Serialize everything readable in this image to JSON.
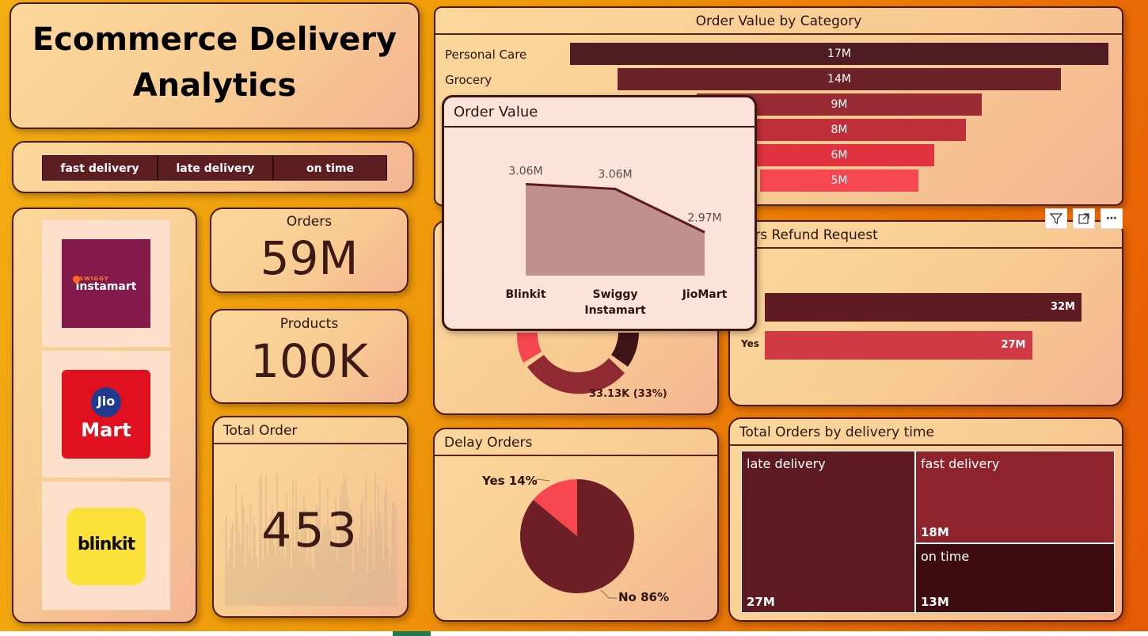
{
  "header": {
    "title_line1": "Ecommerce Delivery",
    "title_line2": "Analytics"
  },
  "filters": {
    "items": [
      "fast delivery",
      "late delivery",
      "on time"
    ]
  },
  "logos": {
    "swiggy_small": "SWIGGY",
    "swiggy_main": "instamart",
    "jio_top": "Jio",
    "jio_bottom": "Mart",
    "blinkit": "blinkit"
  },
  "kpis": {
    "orders_label": "Orders",
    "orders_value": "59M",
    "products_label": "Products",
    "products_value": "100K"
  },
  "total_order": {
    "title": "Total Order",
    "value": "453"
  },
  "order_value_by_category": {
    "title": "Order Value by Category",
    "labels": [
      "Personal Care",
      "Grocery"
    ],
    "bars": [
      {
        "label": "17M",
        "value": 17,
        "color": "#4e1c22"
      },
      {
        "label": "14M",
        "value": 14,
        "color": "#6b2229"
      },
      {
        "label": "9M",
        "value": 9,
        "color": "#9a2a33"
      },
      {
        "label": "8M",
        "value": 8,
        "color": "#c0303b"
      },
      {
        "label": "6M",
        "value": 6,
        "color": "#e0323f"
      },
      {
        "label": "5M",
        "value": 5,
        "color": "#f6464f"
      }
    ]
  },
  "tooltip": {
    "title": "Order Value",
    "chart_data": {
      "type": "area",
      "categories": [
        "Blinkit",
        "Swiggy Instamart",
        "JioMart"
      ],
      "values": [
        3.06,
        3.06,
        2.97
      ],
      "data_labels": [
        "3.06M",
        "3.06M",
        "2.97M"
      ],
      "cat_lines": [
        [
          "Blinkit"
        ],
        [
          "Swiggy",
          "Instamart"
        ],
        [
          "JioMart"
        ]
      ]
    }
  },
  "refund": {
    "title_visible": "ders Refund Request",
    "bars": [
      {
        "category": "",
        "value": 32,
        "label": "32M",
        "color": "#5e1c22"
      },
      {
        "category": "Yes",
        "value": 27,
        "label": "27M",
        "color": "#d03a45"
      }
    ]
  },
  "donut": {
    "label": "33.13K (33%)"
  },
  "delay_orders": {
    "title": "Delay Orders",
    "chart_data": {
      "type": "pie",
      "slices": [
        {
          "name": "Yes",
          "value": 14,
          "label": "Yes 14%",
          "color": "#f6464f"
        },
        {
          "name": "No",
          "value": 86,
          "label": "No 86%",
          "color": "#6e1f26"
        }
      ]
    }
  },
  "delivery_time": {
    "title": "Total Orders by delivery time",
    "tiles": [
      {
        "name": "late delivery",
        "value": "27M",
        "color": "#5e1a21"
      },
      {
        "name": "fast delivery",
        "value": "18M",
        "color": "#8f232b"
      },
      {
        "name": "on time",
        "value": "13M",
        "color": "#3e0c10"
      }
    ]
  },
  "toolbar": {
    "filter_icon": "funnel-icon",
    "focus_icon": "expand-icon",
    "more_label": "⋯"
  }
}
